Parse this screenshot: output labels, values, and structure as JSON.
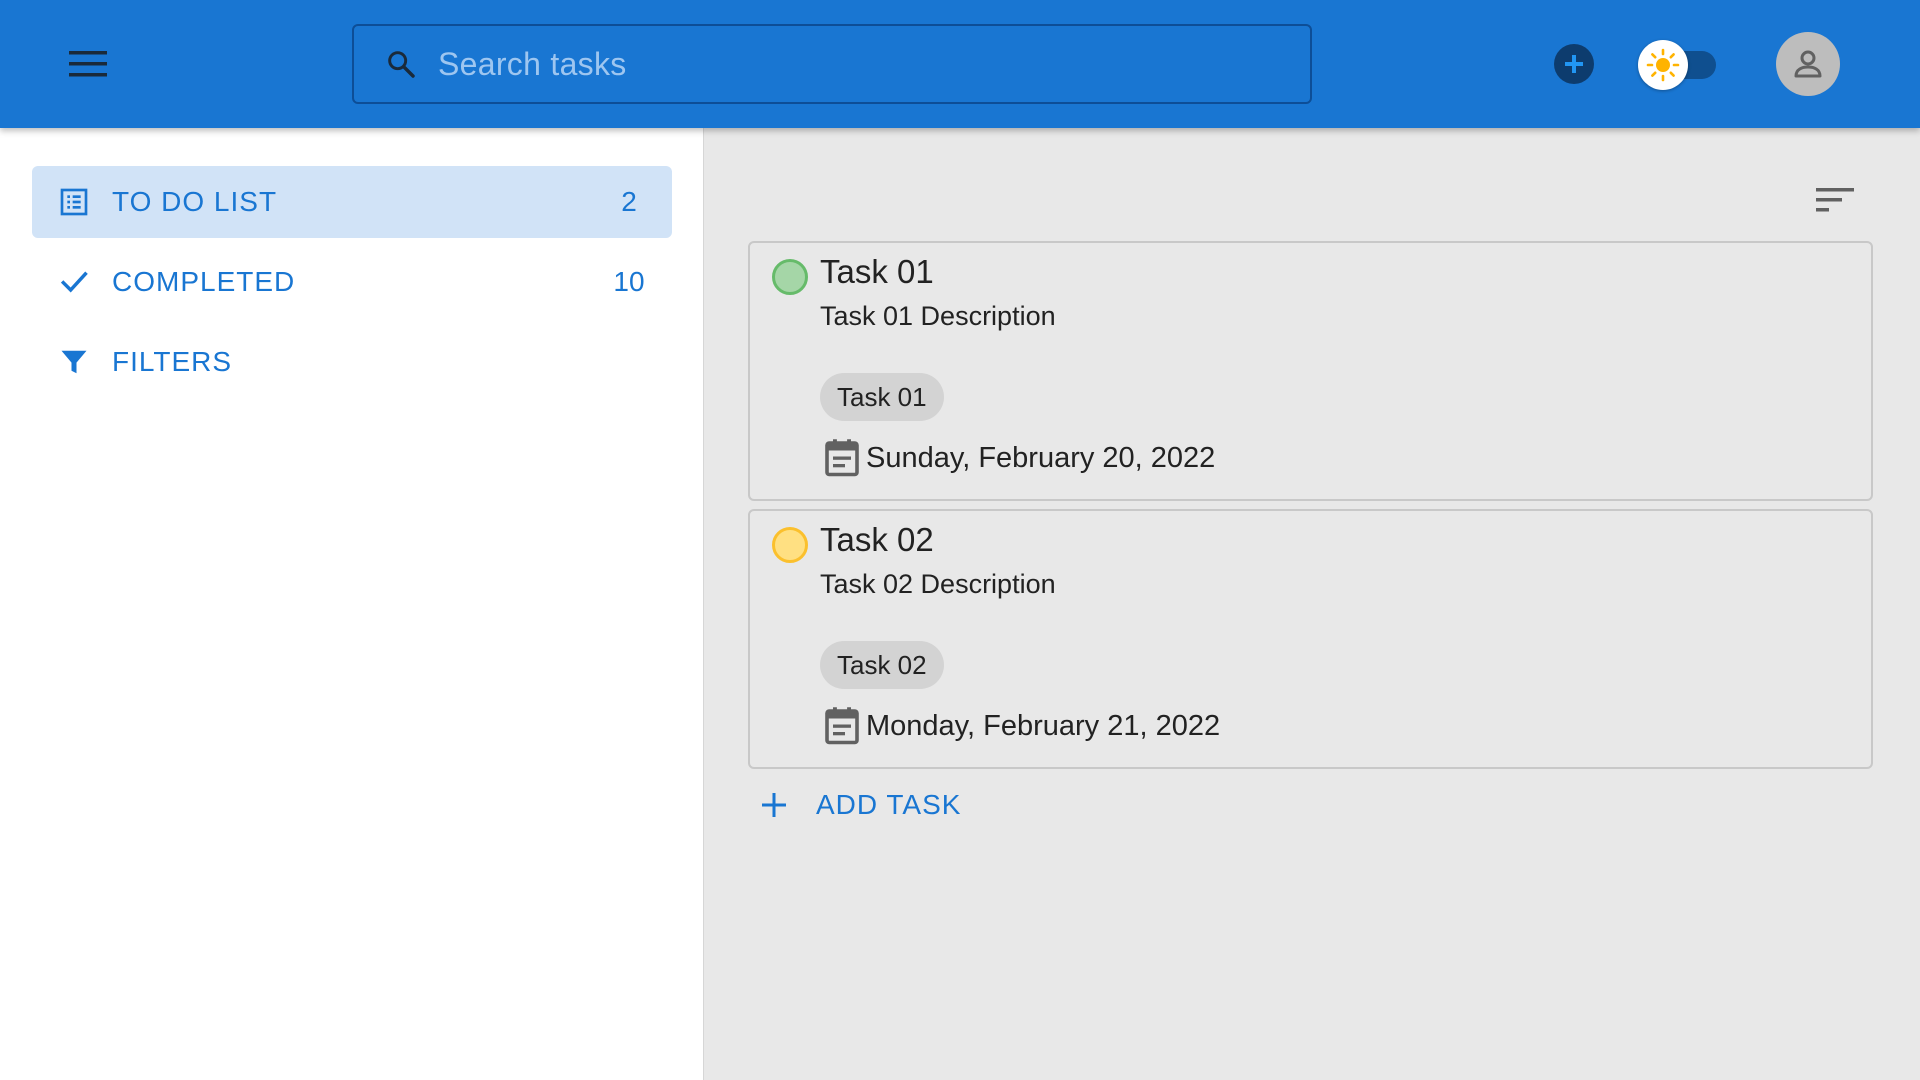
{
  "header": {
    "search_placeholder": "Search tasks",
    "search_value": ""
  },
  "sidebar": {
    "items": [
      {
        "label": "TO DO LIST",
        "count": "2",
        "icon": "list-icon",
        "active": true
      },
      {
        "label": "COMPLETED",
        "count": "10",
        "icon": "check-icon",
        "active": false
      },
      {
        "label": "FILTERS",
        "count": "",
        "icon": "filter-icon",
        "active": false
      }
    ]
  },
  "tasks": [
    {
      "title": "Task 01",
      "description": "Task 01 Description",
      "tag": "Task 01",
      "date": "Sunday, February 20, 2022",
      "status_color": "#a5d6a7",
      "status_border": "#66bb6a"
    },
    {
      "title": "Task 02",
      "description": "Task 02 Description",
      "tag": "Task 02",
      "date": "Monday, February 21, 2022",
      "status_color": "#ffe082",
      "status_border": "#fbc02d"
    }
  ],
  "main": {
    "add_task_label": "ADD TASK"
  },
  "colors": {
    "primary": "#1976d2",
    "active_nav_bg": "#d1e3f7",
    "sun": "#ffb300"
  }
}
